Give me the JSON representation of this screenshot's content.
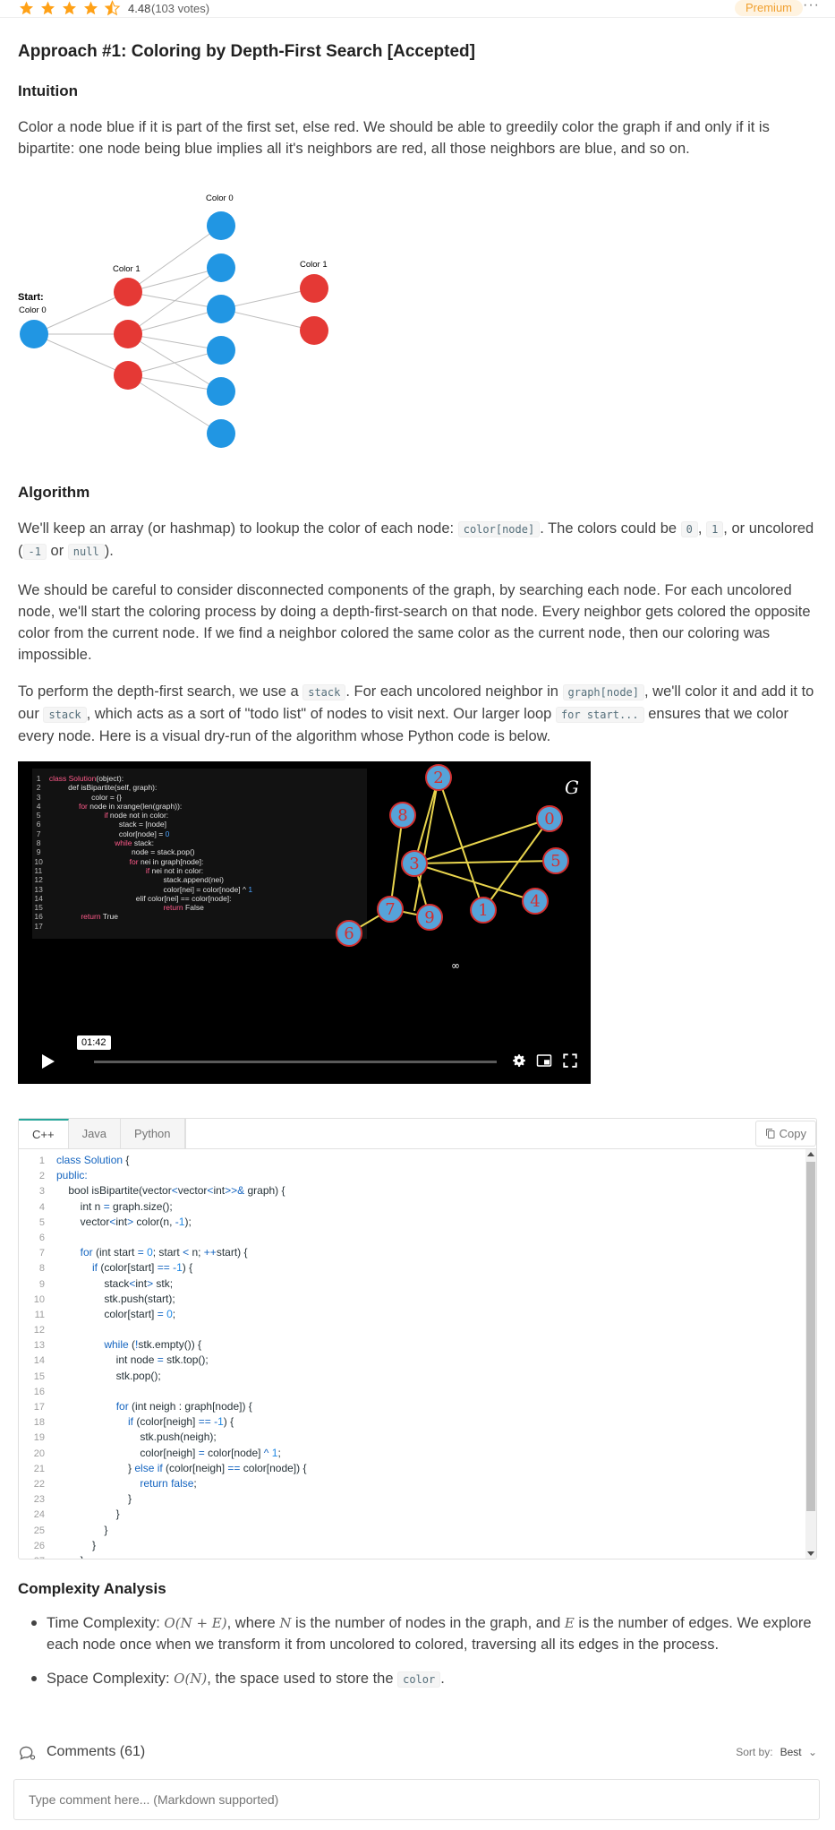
{
  "rating": {
    "value": "4.48",
    "votes": "(103 votes)",
    "stars_filled": 4.5,
    "badge": "Premium"
  },
  "article": {
    "title": "Approach #1: Coloring by Depth-First Search [Accepted]",
    "intuition_heading": "Intuition",
    "intuition_text": "Color a node blue if it is part of the first set, else red. We should be able to greedily color the graph if and only if it is bipartite: one node being blue implies all it's neighbors are red, all those neighbors are blue, and so on.",
    "figure": {
      "label_start": "Start:",
      "label_start_color": "Color 0",
      "label_col1": "Color 1",
      "label_col2": "Color 0",
      "label_col3": "Color 1",
      "blue": "#2196e3",
      "red": "#e53935"
    },
    "algorithm_heading": "Algorithm",
    "algo_p1_a": "We'll keep an array (or hashmap) to lookup the color of each node: ",
    "algo_p1_code": "color[node]",
    "algo_p1_b": ". The colors could be ",
    "algo_p1_c0": "0",
    "algo_p1_sep": ", ",
    "algo_p1_c1": "1",
    "algo_p1_c": ", or uncolored (",
    "algo_p1_cm1": "-1",
    "algo_p1_or": " or ",
    "algo_p1_null": "null",
    "algo_p1_end": ").",
    "algo_p2": "We should be careful to consider disconnected components of the graph, by searching each node. For each uncolored node, we'll start the coloring process by doing a depth-first-search on that node. Every neighbor gets colored the opposite color from the current node. If we find a neighbor colored the same color as the current node, then our coloring was impossible.",
    "algo_p3_a": "To perform the depth-first search, we use a ",
    "algo_p3_stack": "stack",
    "algo_p3_b": ". For each uncolored neighbor in ",
    "algo_p3_graph": "graph[node]",
    "algo_p3_c": ", we'll color it and add it to our ",
    "algo_p3_stack2": "stack",
    "algo_p3_d": ", which acts as a sort of \"todo list\" of nodes to visit next. Our larger loop ",
    "algo_p3_for": "for start...",
    "algo_p3_e": " ensures that we color every node. Here is a visual dry-run of the algorithm whose Python code is below."
  },
  "video": {
    "code_lines": [
      "1",
      "2",
      "3",
      "4",
      "5",
      "6",
      "7",
      "8",
      "9",
      "10",
      "11",
      "12",
      "13",
      "14",
      "15",
      "16",
      "17"
    ],
    "timestamp": "01:42",
    "graph_letter": "G",
    "graph_nodes": [
      "2",
      "8",
      "0",
      "3",
      "5",
      "4",
      "7",
      "9",
      "1",
      "6"
    ],
    "infinity": "∞"
  },
  "editor": {
    "tabs": [
      "C++",
      "Java",
      "Python"
    ],
    "active_tab": "C++",
    "copy_label": "Copy"
  },
  "complexity": {
    "heading": "Complexity Analysis",
    "time_label": "Time Complexity: ",
    "time_math": "O(N + E)",
    "time_a": ", where ",
    "time_n": "N",
    "time_b": " is the number of nodes in the graph, and ",
    "time_e": "E",
    "time_c": " is the number of edges. We explore each node once when we transform it from uncolored to colored, traversing all its edges in the process.",
    "space_label": "Space Complexity: ",
    "space_math": "O(N)",
    "space_a": ", the space used to store the ",
    "space_code": "color",
    "space_b": "."
  },
  "comments": {
    "title": "Comments (61)",
    "sort_label": "Sort by:",
    "sort_value": "Best",
    "placeholder": "Type comment here... (Markdown supported)"
  }
}
